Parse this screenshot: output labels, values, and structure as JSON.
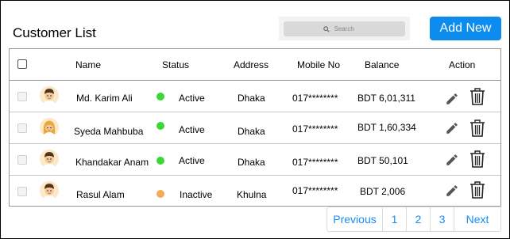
{
  "header": {
    "title": "Customer List",
    "search_placeholder": "Search",
    "add_label": "Add New"
  },
  "table": {
    "columns": [
      "Name",
      "Status",
      "Address",
      "Mobile No",
      "Balance",
      "Action"
    ],
    "rows": [
      {
        "name": "Md. Karim Ali",
        "status": "Active",
        "status_color": "#3ad63a",
        "address": "Dhaka",
        "mobile": "017********",
        "balance": "BDT 6,01,311",
        "avatar": "male-avatar-icon"
      },
      {
        "name": "Syeda Mahbuba",
        "status": "Active",
        "status_color": "#3ad63a",
        "address": "Dhaka",
        "mobile": "017********",
        "balance": "BDT 1,60,334",
        "avatar": "female-avatar-icon"
      },
      {
        "name": "Khandakar Anam",
        "status": "Active",
        "status_color": "#3ad63a",
        "address": "Dhaka",
        "mobile": "017********",
        "balance": "BDT 50,101",
        "avatar": "male-avatar-icon"
      },
      {
        "name": "Rasul Alam",
        "status": "Inactive",
        "status_color": "#f5a85a",
        "address": "Khulna",
        "mobile": "017********",
        "balance": "BDT 2,006",
        "avatar": "male-avatar-icon"
      }
    ],
    "action_icons": [
      "pencil-icon",
      "trash-icon"
    ]
  },
  "pagination": {
    "previous": "Previous",
    "pages": [
      "1",
      "2",
      "3"
    ],
    "next": "Next"
  },
  "colors": {
    "accent": "#0d8cf0",
    "active": "#3ad63a",
    "inactive": "#f5a85a",
    "link": "#1a8cf0"
  }
}
